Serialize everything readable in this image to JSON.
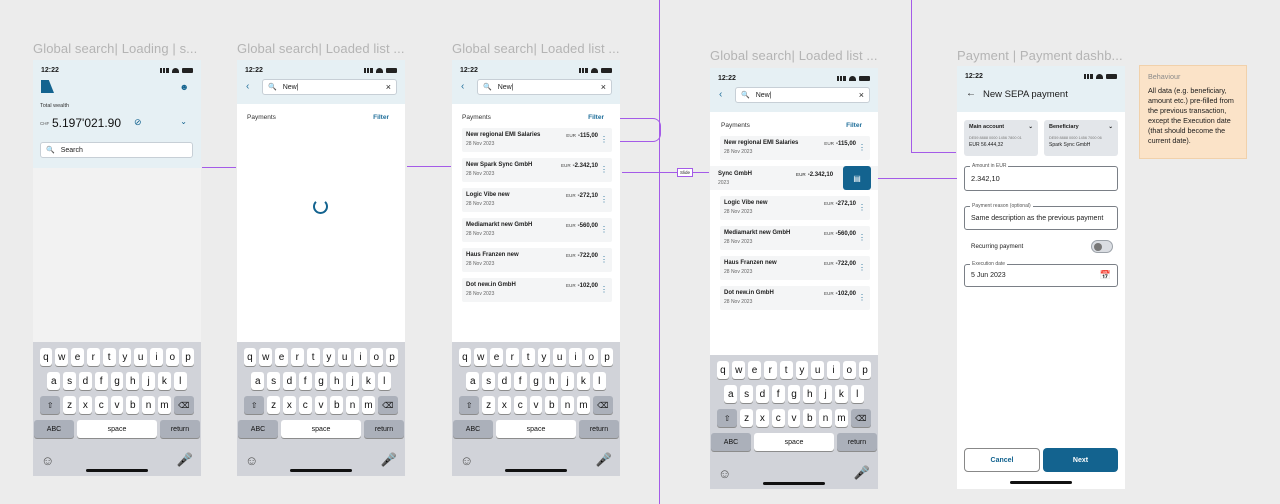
{
  "frames": [
    {
      "title": "Global search| Loading | s..."
    },
    {
      "title": "Global search| Loaded list ..."
    },
    {
      "title": "Global search| Loaded list ..."
    },
    {
      "title": "Global search| Loaded list ..."
    },
    {
      "title": "Payment | Payment dashb..."
    }
  ],
  "status_time": "12:22",
  "dashboard": {
    "total_wealth_label": "Total wealth",
    "currency": "CHF",
    "amount": "5.197'021.90",
    "search_placeholder": "Search"
  },
  "search_query": "New|",
  "payments_label": "Payments",
  "filter_label": "Filter",
  "payments": [
    {
      "name": "New regional EMI Salaries",
      "date": "28 Nov 2023",
      "currency": "EUR",
      "amount": "-115,00"
    },
    {
      "name": "New Spark Sync GmbH",
      "date": "28 Nov 2023",
      "currency": "EUR",
      "amount": "-2.342,10"
    },
    {
      "name": "Logic Vibe new",
      "date": "28 Nov 2023",
      "currency": "EUR",
      "amount": "-272,10"
    },
    {
      "name": "Mediamarkt new GmbH",
      "date": "28 Nov 2023",
      "currency": "EUR",
      "amount": "-560,00"
    },
    {
      "name": "Haus Franzen new",
      "date": "28 Nov 2023",
      "currency": "EUR",
      "amount": "-722,00"
    },
    {
      "name": "Dot new.in GmbH",
      "date": "28 Nov 2023",
      "currency": "EUR",
      "amount": "-102,00"
    }
  ],
  "swiped_row": {
    "name": "Sync GmbH",
    "date": "2023",
    "currency": "EUR",
    "amount": "-2.342,10"
  },
  "swipe_label": "Slide",
  "keyboard": {
    "row1": [
      "q",
      "w",
      "e",
      "r",
      "t",
      "y",
      "u",
      "i",
      "o",
      "p"
    ],
    "row2": [
      "a",
      "s",
      "d",
      "f",
      "g",
      "h",
      "j",
      "k",
      "l"
    ],
    "row3": [
      "z",
      "x",
      "c",
      "v",
      "b",
      "n",
      "m"
    ],
    "abc": "ABC",
    "space": "space",
    "return": "return"
  },
  "sepa": {
    "title": "New SEPA payment",
    "main_account_label": "Main account",
    "main_account_iban": "DE59 8888 0000 1456 7800 01",
    "main_account_balance": "EUR 56.444,32",
    "beneficiary_label": "Beneficiary",
    "beneficiary_iban": "DE59 8888 0000 1456 7000 06",
    "beneficiary_name": "Spark Sync GmbH",
    "amount_label": "Amount in EUR",
    "amount_value": "2.342,10",
    "reason_label": "Payment reason (optional)",
    "reason_value": "Same description as the previous payment",
    "recurring_label": "Recurring payment",
    "exec_label": "Execution date",
    "exec_value": "5 Jun 2023",
    "cancel": "Cancel",
    "next": "Next"
  },
  "behaviour": {
    "heading": "Behaviour",
    "text": "All data (e.g. beneficiary, amount etc.) pre-filled from the previous transaction, except the Execution date (that should become the current date)."
  },
  "colors": {
    "primary": "#13638f",
    "connector": "#a45be8",
    "sticky": "#fbe3c8"
  }
}
